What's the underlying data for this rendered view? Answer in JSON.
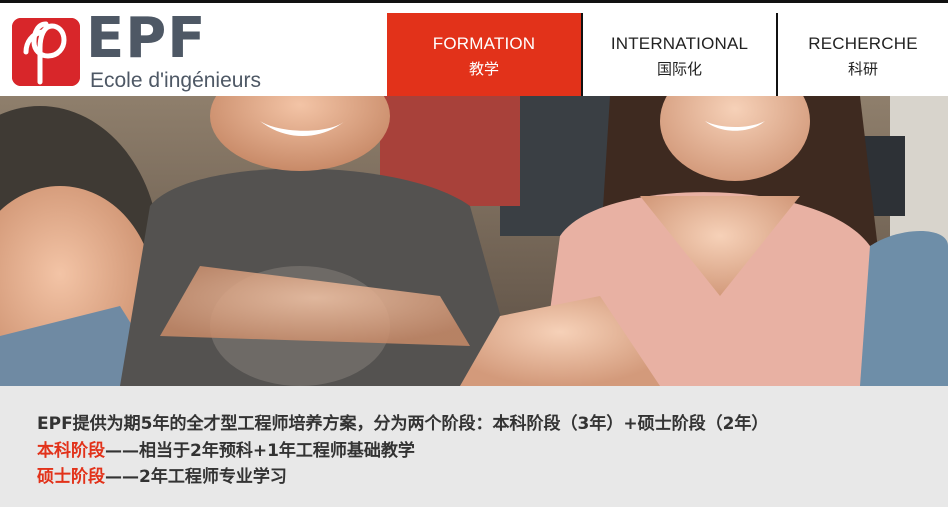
{
  "brand": {
    "name": "EPF",
    "subtitle": "Ecole d'ingénieurs",
    "badge_color": "#d8262a",
    "text_color": "#4e5865"
  },
  "nav": {
    "items": [
      {
        "label_fr": "FORMATION",
        "label_cn": "教学",
        "active": true
      },
      {
        "label_fr": "INTERNATIONAL",
        "label_cn": "国际化",
        "active": false
      },
      {
        "label_fr": "RECHERCHE",
        "label_cn": "科研",
        "active": false
      }
    ],
    "active_color": "#e2321a"
  },
  "hero": {
    "icon": "students-photo"
  },
  "info": {
    "line1": "EPF提供为期5年的全才型工程师培养方案，分为两个阶段：本科阶段（3年）+硕士阶段（2年）",
    "line2_highlight": "本科阶段",
    "line2_rest": "——相当于2年预科+1年工程师基础教学",
    "line3_highlight": "硕士阶段",
    "line3_rest": "——2年工程师专业学习",
    "highlight_color": "#e2321a"
  }
}
